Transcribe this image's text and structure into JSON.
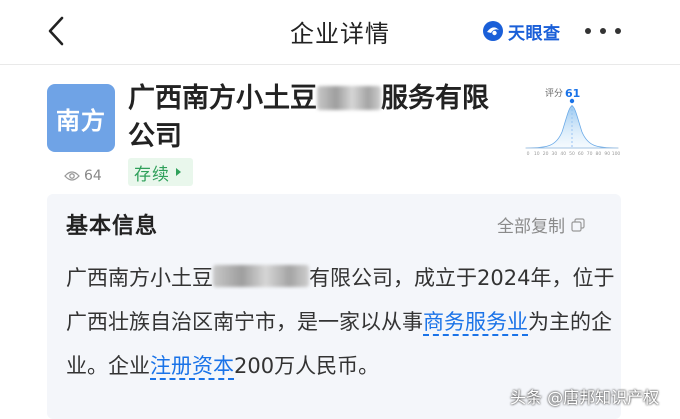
{
  "header": {
    "title": "企业详情",
    "brand_name": "天眼查",
    "brand_color": "#1a5fd8"
  },
  "company": {
    "logo_text": "南方",
    "logo_color": "#6fa3e6",
    "name_prefix": "广西南方小土豆",
    "name_suffix": "服务有限公司",
    "views": "64",
    "status": "存续",
    "status_color": "#2fa05a"
  },
  "score": {
    "label": "评分",
    "value": "61",
    "ticks": [
      "0",
      "10",
      "20",
      "30",
      "40",
      "50",
      "60",
      "70",
      "80",
      "90",
      "100"
    ]
  },
  "basic_info": {
    "title": "基本信息",
    "copy_label": "全部复制",
    "desc_part1": "广西南方小土豆",
    "desc_part2": "有限公司，成立于2024年，位于广西壮族自治区南宁市，是一家以从事",
    "industry_link": "商务服务业",
    "desc_part3": "为主的企业。企业",
    "capital_link": "注册资本",
    "desc_part4": "200万人民币。"
  },
  "watermark": "头条 @唐邦知识产权",
  "link_color": "#1a73e8"
}
